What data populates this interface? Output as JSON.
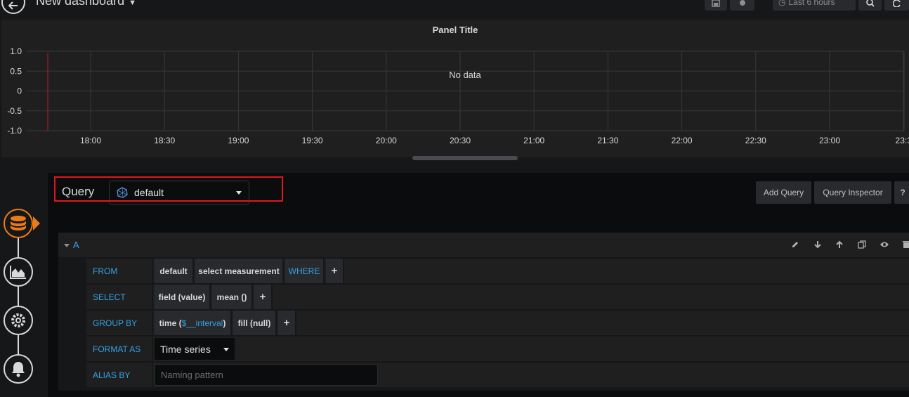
{
  "header": {
    "dashboard_title": "New dashboard",
    "time_range": "Last 6 hours"
  },
  "panel": {
    "title": "Panel Title",
    "no_data": "No data"
  },
  "chart_data": {
    "type": "line",
    "title": "Panel Title",
    "y_ticks": [
      "1.0",
      "0.5",
      "0",
      "-0.5",
      "-1.0"
    ],
    "ylim": [
      -1.0,
      1.0
    ],
    "x_ticks": [
      "18:00",
      "18:30",
      "19:00",
      "19:30",
      "20:00",
      "20:30",
      "21:00",
      "21:30",
      "22:00",
      "22:30",
      "23:00",
      "23:3"
    ],
    "series": [],
    "annotation": "No data",
    "grid": true
  },
  "editor": {
    "query_label": "Query",
    "datasource": "default",
    "add_query": "Add Query",
    "query_inspector": "Query Inspector",
    "help": "?",
    "query_letter": "A",
    "rows": {
      "from": {
        "keyword": "FROM",
        "policy": "default",
        "measurement": "select measurement",
        "where": "WHERE",
        "plus": "+"
      },
      "select": {
        "keyword": "SELECT",
        "field": "field (value)",
        "fn": "mean ()",
        "plus": "+"
      },
      "group_by": {
        "keyword": "GROUP BY",
        "time_prefix": "time (",
        "time_var": "$__interval",
        "time_suffix": ")",
        "fill": "fill (null)",
        "plus": "+"
      },
      "format_as": {
        "keyword": "FORMAT AS",
        "value": "Time series"
      },
      "alias_by": {
        "keyword": "ALIAS BY",
        "placeholder": "Naming pattern"
      }
    }
  },
  "colors": {
    "accent_blue": "#33a2e5",
    "active_orange": "#eb7b18",
    "highlight_red": "#e0161b",
    "threshold_red": "#c4162a"
  }
}
